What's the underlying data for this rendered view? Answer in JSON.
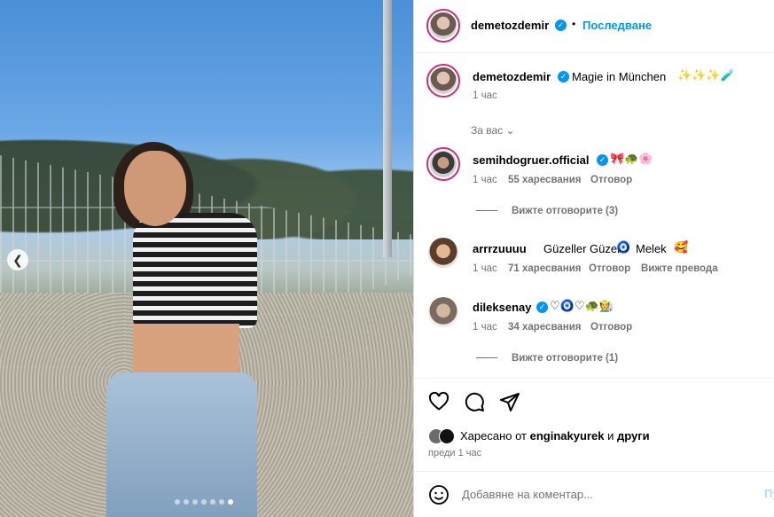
{
  "post": {
    "author": "demetozdemir",
    "follow_label": "Последване",
    "separator": "•",
    "caption": "Magie in München",
    "caption_emoji": "✨✨✨🧪",
    "time": "1 час",
    "filter_label": "За вас",
    "carousel": {
      "total": 7,
      "active": 6
    }
  },
  "comments": [
    {
      "user": "semihdogruer.official",
      "verified": true,
      "text": "",
      "emoji": "🎀🐢🌸",
      "time": "1 час",
      "likes": "55 харесвания",
      "reply": "Отговор",
      "translate": "",
      "view_replies": "Вижте отговорите (3)"
    },
    {
      "user": "arrrzuuuu",
      "verified": false,
      "text": "Güzeller Güzeli",
      "text2": "Melek",
      "emoji_mid": "🧿",
      "emoji_end": "🥰",
      "time": "1 час",
      "likes": "71 харесвания",
      "reply": "Отговор",
      "translate": "Вижте превода"
    },
    {
      "user": "dileksenay",
      "verified": true,
      "emoji": "♡🧿♡🐢🧑‍🌾",
      "time": "1 час",
      "likes": "34 харесвания",
      "reply": "Отговор",
      "view_replies": "Вижте отговорите (1)"
    }
  ],
  "likes": {
    "prefix": "Харесано от",
    "user": "enginakyurek",
    "joiner": "и",
    "others": "други",
    "time": "преди 1 час"
  },
  "composer": {
    "placeholder": "Добавяне на коментар...",
    "post_label": "Пу"
  },
  "icons": {
    "like": "heart-icon",
    "comment": "comment-icon",
    "share": "share-icon",
    "emoji": "smiley-icon",
    "verified": "verified-badge-icon",
    "prev": "chevron-left-icon"
  },
  "colors": {
    "link": "#0095f6",
    "muted": "#737373",
    "story_ring": "#d62976"
  }
}
